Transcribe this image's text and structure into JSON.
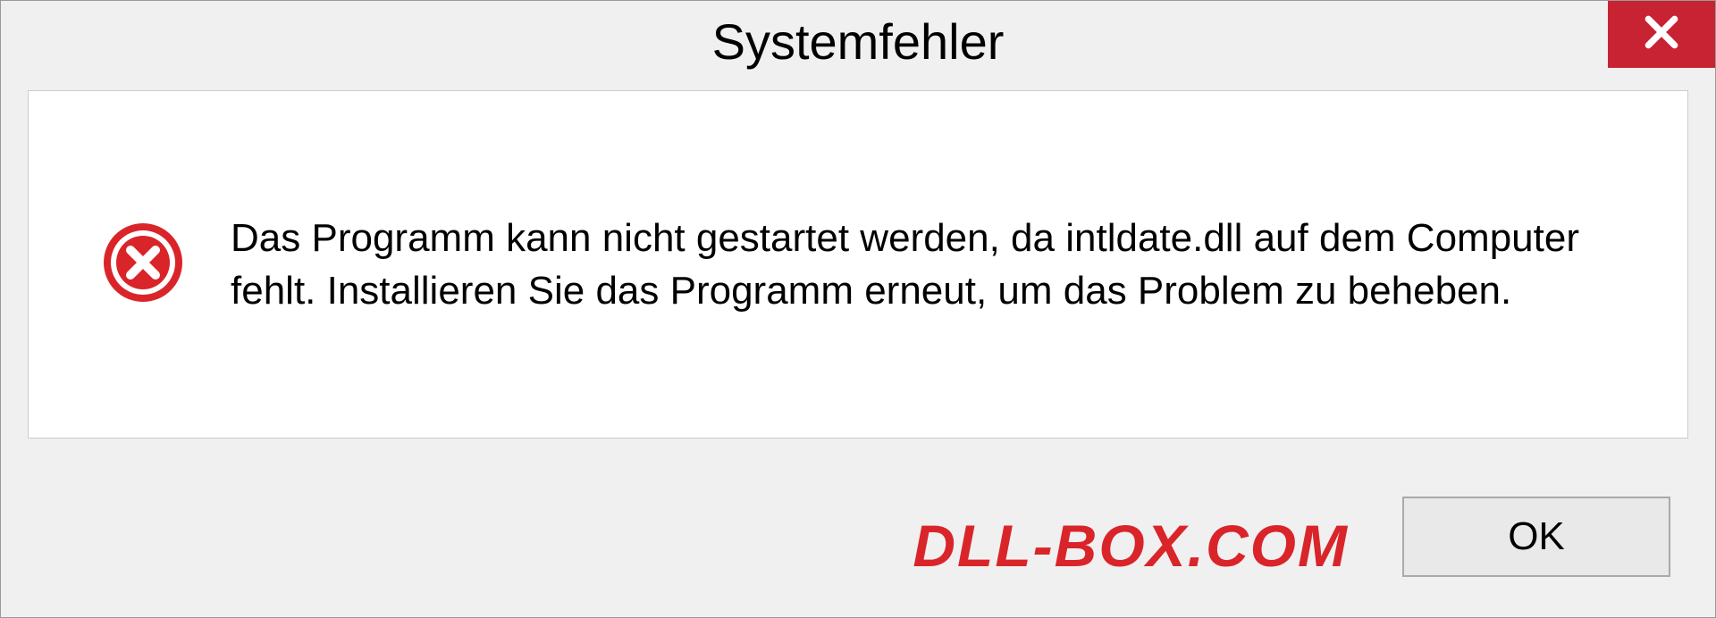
{
  "dialog": {
    "title": "Systemfehler",
    "message": "Das Programm kann nicht gestartet werden, da intldate.dll auf dem Computer fehlt. Installieren Sie das Programm erneut, um das Problem zu beheben.",
    "ok_label": "OK"
  },
  "watermark": "DLL-BOX.COM",
  "colors": {
    "close_bg": "#c82333",
    "error_red": "#d9252a"
  }
}
